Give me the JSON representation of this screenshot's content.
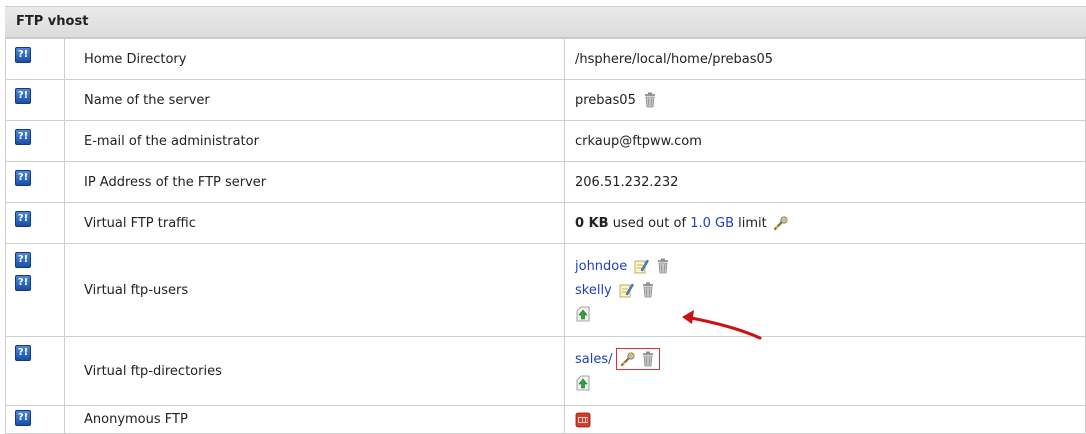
{
  "panel": {
    "title": "FTP vhost"
  },
  "rows": [
    {
      "label": "Home Directory",
      "value": "/hsphere/local/home/prebas05"
    },
    {
      "label": "Name of the server",
      "value": "prebas05"
    },
    {
      "label": "E-mail of the administrator",
      "value": "crkaup@ftpww.com"
    },
    {
      "label": "IP Address of the FTP server",
      "value": "206.51.232.232"
    },
    {
      "label": "Virtual FTP traffic",
      "traffic": {
        "used": "0 KB",
        "mid": " used out of ",
        "limit": "1.0 GB",
        "suffix": " limit"
      }
    },
    {
      "label": "Virtual ftp-users",
      "users": [
        "johndoe",
        "skelly"
      ]
    },
    {
      "label": "Virtual ftp-directories",
      "dirs": [
        "sales/"
      ]
    },
    {
      "label": "Anonymous FTP"
    }
  ],
  "icons": {
    "help": "help-icon",
    "trash": "trash-icon",
    "edit": "edit-icon",
    "wrench": "wrench-icon",
    "add": "add-icon",
    "off": "off-icon"
  },
  "help_glyph": "?!",
  "colors": {
    "link": "#1f3fbf",
    "highlight": "#dd3333",
    "arrow": "#cc1111",
    "header_bg": "#e2e2e2"
  }
}
